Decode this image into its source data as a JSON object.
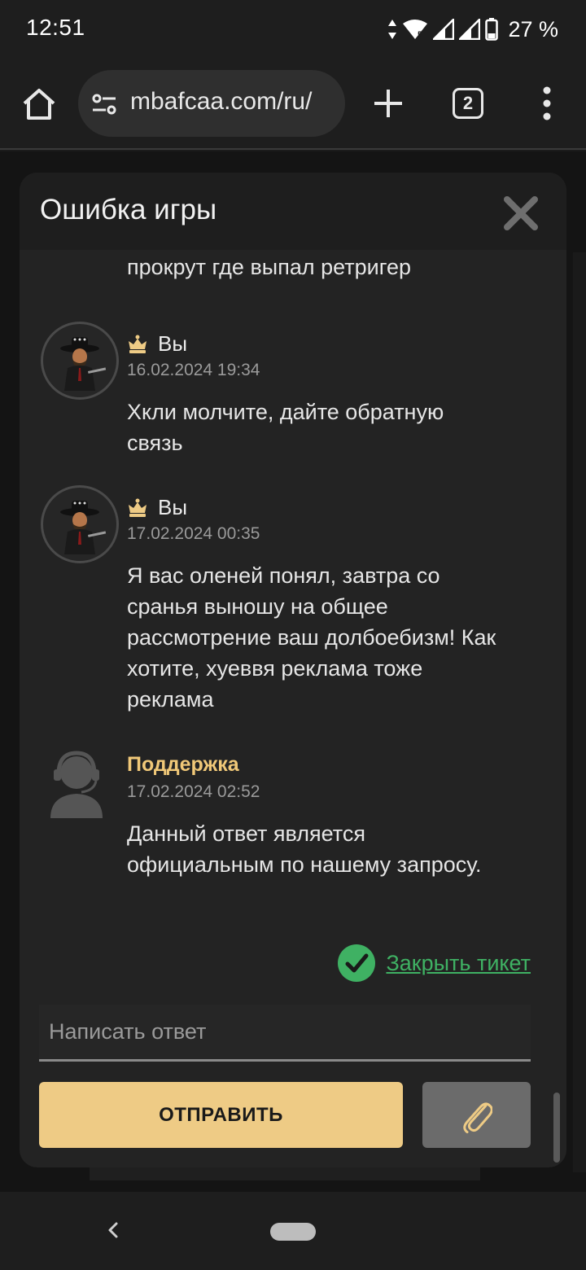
{
  "status_bar": {
    "time": "12:51",
    "battery": "27 %",
    "icons": [
      "data-arrows-icon",
      "wifi-icon",
      "signal-icon",
      "signal-icon",
      "battery-icon"
    ]
  },
  "browser": {
    "url": "mbafcaa.com/ru/",
    "tab_count": "2",
    "icons": [
      "home-icon",
      "site-settings-icon",
      "plus-icon",
      "tabs-icon",
      "more-vert-icon"
    ]
  },
  "modal": {
    "title": "Ошибка игры",
    "close_icon": "close-icon",
    "partial_message": "прокрут где выпал ретригер",
    "messages": [
      {
        "author": "Вы",
        "date": "16.02.2024 19:34",
        "lines": [
          "Хкли молчите, дайте обратную",
          "связь"
        ]
      },
      {
        "author": "Вы",
        "date": "17.02.2024 00:35",
        "lines": [
          "Я вас оленей понял, завтра со",
          "сранья выношу на общее",
          "рассмотрение ваш долбоебизм! Как",
          "хотите, хуеввя реклама тоже",
          "реклама"
        ]
      },
      {
        "author": "Поддержка",
        "date": "17.02.2024 02:52",
        "lines": [
          "Данный ответ является",
          "официальным по нашему запросу."
        ]
      }
    ],
    "close_ticket_label": "Закрыть тикет",
    "reply_placeholder": "Написать ответ",
    "send_label": "ОТПРАВИТЬ",
    "attach_icon": "paperclip-icon",
    "colors": {
      "accent": "#eecb85",
      "success": "#3fb163",
      "support_name": "#f0c878",
      "modal_bg": "#232323"
    }
  },
  "nav_bar": {
    "icons": [
      "back-icon",
      "home-pill-icon"
    ]
  }
}
